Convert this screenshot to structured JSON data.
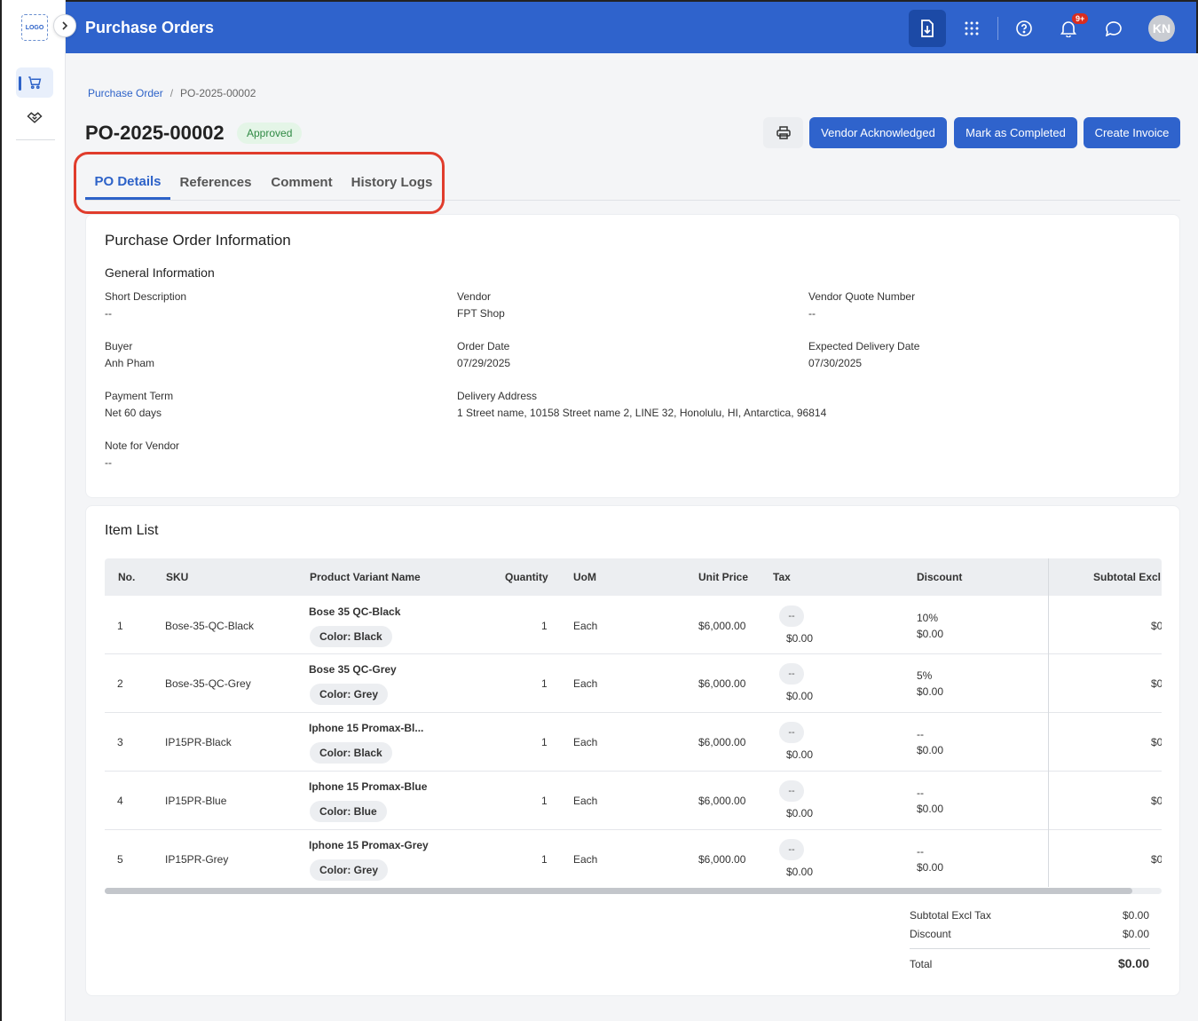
{
  "app": {
    "logo_text": "LOGO",
    "title": "Purchase Orders",
    "notification_count": "9+",
    "avatar_initials": "KN",
    "rail_items": [
      {
        "icon": "cart-icon",
        "active": true
      },
      {
        "icon": "handshake-icon",
        "active": false
      }
    ]
  },
  "breadcrumb": {
    "parent": "Purchase Order",
    "separator": "/",
    "current": "PO-2025-00002"
  },
  "po": {
    "number": "PO-2025-00002",
    "status": "Approved",
    "status_color": "#2f8a44"
  },
  "actions": {
    "vendor_ack": "Vendor Acknowledged",
    "mark_completed": "Mark as Completed",
    "create_invoice": "Create Invoice"
  },
  "tabs": [
    {
      "label": "PO Details",
      "active": true
    },
    {
      "label": "References",
      "active": false
    },
    {
      "label": "Comment",
      "active": false
    },
    {
      "label": "History Logs",
      "active": false
    }
  ],
  "info": {
    "card_title": "Purchase Order Information",
    "section_title": "General Information",
    "fields": {
      "short_description": {
        "label": "Short Description",
        "value": "--"
      },
      "vendor": {
        "label": "Vendor",
        "value": "FPT Shop"
      },
      "vendor_quote": {
        "label": "Vendor Quote Number",
        "value": "--"
      },
      "buyer": {
        "label": "Buyer",
        "value": "Anh Pham"
      },
      "order_date": {
        "label": "Order Date",
        "value": "07/29/2025"
      },
      "expected_delivery": {
        "label": "Expected Delivery Date",
        "value": "07/30/2025"
      },
      "payment_term": {
        "label": "Payment Term",
        "value": "Net 60 days"
      },
      "delivery_address": {
        "label": "Delivery Address",
        "value": "1 Street name, 10158 Street name 2, LINE 32, Honolulu, HI, Antarctica, 96814"
      },
      "note_for_vendor": {
        "label": "Note for Vendor",
        "value": "--"
      }
    }
  },
  "items": {
    "card_title": "Item List",
    "columns": {
      "no": "No.",
      "sku": "SKU",
      "name": "Product Variant Name",
      "quantity": "Quantity",
      "uom": "UoM",
      "unit_price": "Unit Price",
      "tax": "Tax",
      "discount": "Discount",
      "subtotal": "Subtotal Excl T"
    },
    "rows": [
      {
        "no": "1",
        "sku": "Bose-35-QC-Black",
        "name": "Bose 35 QC-Black",
        "variant": "Color: Black",
        "quantity": "1",
        "uom": "Each",
        "unit_price": "$6,000.00",
        "tax_rate": "--",
        "tax_amount": "$0.00",
        "discount_rate": "10%",
        "discount_amount": "$0.00",
        "subtotal": "$0"
      },
      {
        "no": "2",
        "sku": "Bose-35-QC-Grey",
        "name": "Bose 35 QC-Grey",
        "variant": "Color: Grey",
        "quantity": "1",
        "uom": "Each",
        "unit_price": "$6,000.00",
        "tax_rate": "--",
        "tax_amount": "$0.00",
        "discount_rate": "5%",
        "discount_amount": "$0.00",
        "subtotal": "$0"
      },
      {
        "no": "3",
        "sku": "IP15PR-Black",
        "name": "Iphone 15 Promax-Bl...",
        "variant": "Color: Black",
        "quantity": "1",
        "uom": "Each",
        "unit_price": "$6,000.00",
        "tax_rate": "--",
        "tax_amount": "$0.00",
        "discount_rate": "--",
        "discount_amount": "$0.00",
        "subtotal": "$0"
      },
      {
        "no": "4",
        "sku": "IP15PR-Blue",
        "name": "Iphone 15 Promax-Blue",
        "variant": "Color: Blue",
        "quantity": "1",
        "uom": "Each",
        "unit_price": "$6,000.00",
        "tax_rate": "--",
        "tax_amount": "$0.00",
        "discount_rate": "--",
        "discount_amount": "$0.00",
        "subtotal": "$0"
      },
      {
        "no": "5",
        "sku": "IP15PR-Grey",
        "name": "Iphone 15 Promax-Grey",
        "variant": "Color: Grey",
        "quantity": "1",
        "uom": "Each",
        "unit_price": "$6,000.00",
        "tax_rate": "--",
        "tax_amount": "$0.00",
        "discount_rate": "--",
        "discount_amount": "$0.00",
        "subtotal": "$0"
      }
    ],
    "summary": {
      "subtotal_label": "Subtotal Excl Tax",
      "subtotal_value": "$0.00",
      "discount_label": "Discount",
      "discount_value": "$0.00",
      "total_label": "Total",
      "total_value": "$0.00"
    }
  },
  "colors": {
    "brand": "#2f63cc",
    "highlight": "#e03c2c"
  }
}
